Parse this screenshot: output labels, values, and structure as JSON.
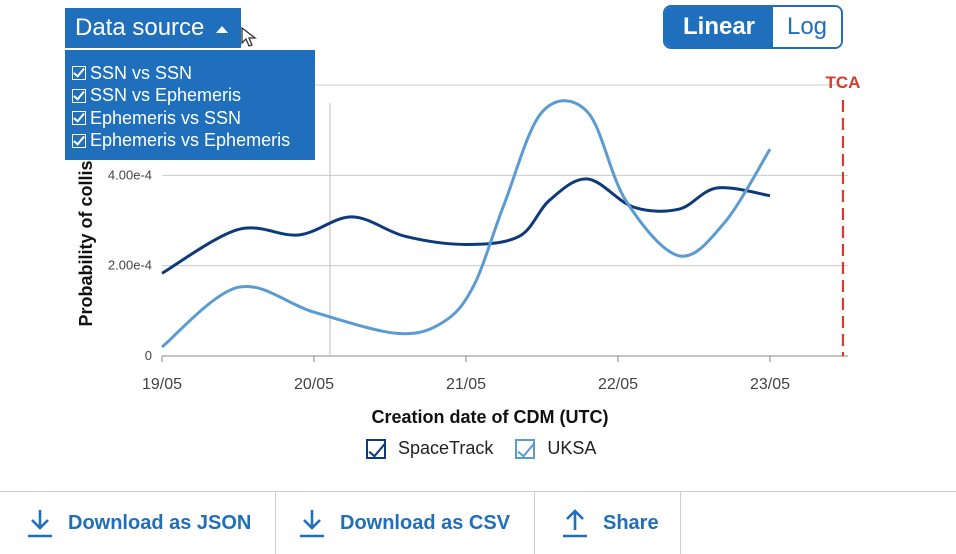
{
  "data_source": {
    "label": "Data source",
    "options": [
      {
        "label": "SSN vs SSN",
        "checked": true
      },
      {
        "label": "SSN vs Ephemeris",
        "checked": true
      },
      {
        "label": "Ephemeris vs SSN",
        "checked": true
      },
      {
        "label": "Ephemeris vs Ephemeris",
        "checked": true
      }
    ]
  },
  "scale_toggle": {
    "linear": "Linear",
    "log": "Log",
    "selected": "Linear"
  },
  "chart_data": {
    "type": "line",
    "xlabel": "Creation date of CDM (UTC)",
    "ylabel": "Probability of collision",
    "x_ticks": [
      "19/05",
      "20/05",
      "21/05",
      "22/05",
      "23/05"
    ],
    "y_ticks": [
      "0",
      "2.00e-4",
      "4.00e-4"
    ],
    "ylim": [
      0,
      0.0006
    ],
    "grid": true,
    "annotation": {
      "label": "TCA",
      "x": 4.48,
      "color": "#d93a2b"
    },
    "series": [
      {
        "name": "SpaceTrack",
        "color": "#0d3a7a",
        "x": [
          0,
          0.5,
          0.9,
          1.25,
          1.6,
          2.0,
          2.35,
          2.55,
          2.8,
          3.1,
          3.4,
          3.65,
          4.0
        ],
        "y": [
          0.000183,
          0.00028,
          0.000268,
          0.000308,
          0.000265,
          0.000247,
          0.000265,
          0.000345,
          0.000392,
          0.00033,
          0.000325,
          0.000372,
          0.000355
        ]
      },
      {
        "name": "UKSA",
        "color": "#5b9bd1",
        "x": [
          0,
          0.5,
          1.0,
          1.55,
          1.85,
          2.05,
          2.25,
          2.5,
          2.8,
          3.05,
          3.4,
          3.7,
          4.0
        ],
        "y": [
          2e-05,
          0.000152,
          9.7e-05,
          5e-05,
          7.5e-05,
          0.000155,
          0.000335,
          0.00054,
          0.00054,
          0.000345,
          0.000222,
          0.000295,
          0.000458
        ]
      }
    ],
    "legend_position": "bottom"
  },
  "actions": {
    "download_json": "Download as JSON",
    "download_csv": "Download as CSV",
    "share": "Share"
  },
  "colors": {
    "primary": "#1f6fbd",
    "tca": "#d93a2b",
    "grid": "#cccccc"
  },
  "icons": {
    "download": "download-icon",
    "share": "share-icon",
    "caret": "caret-up-icon",
    "cursor": "cursor-icon"
  }
}
